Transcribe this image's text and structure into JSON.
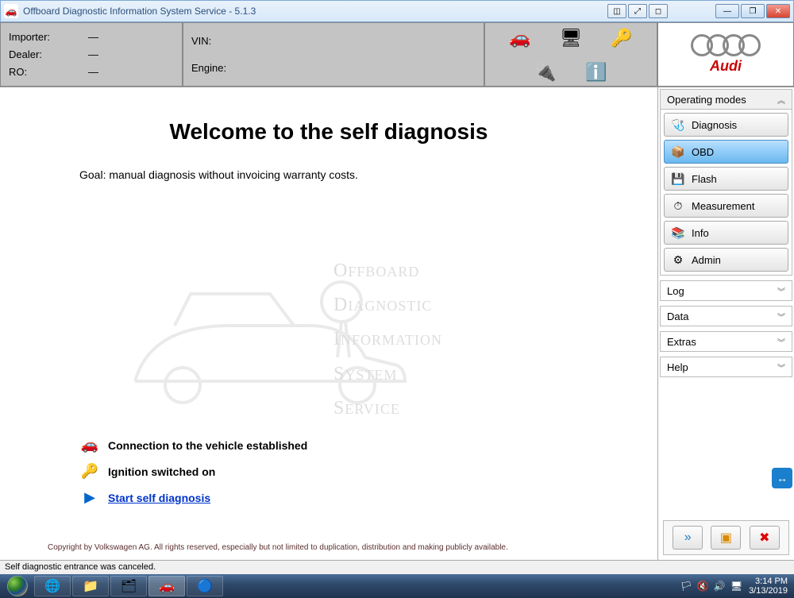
{
  "titlebar": {
    "title": "Offboard Diagnostic Information System Service - 5.1.3"
  },
  "header": {
    "importer_label": "Importer:",
    "importer_val": "—",
    "dealer_label": "Dealer:",
    "dealer_val": "—",
    "ro_label": "RO:",
    "ro_val": "—",
    "vin_label": "VIN:",
    "vin_val": "",
    "engine_label": "Engine:",
    "engine_val": "",
    "brand": "Audi"
  },
  "main": {
    "title": "Welcome to the self diagnosis",
    "goal": "Goal: manual diagnosis without invoicing warranty costs.",
    "watermark_lines": [
      "Offboard",
      "Diagnostic",
      "Information",
      "System",
      "service"
    ],
    "status": {
      "connection": "Connection to the vehicle established",
      "ignition": "Ignition switched on",
      "start": "Start self diagnosis"
    },
    "copyright": "Copyright by Volkswagen AG. All rights reserved, especially but not limited to duplication, distribution and making publicly available."
  },
  "sidebar": {
    "operating_modes_label": "Operating modes",
    "items": [
      {
        "label": "Diagnosis",
        "icon": "🩺"
      },
      {
        "label": "OBD",
        "icon": "📦"
      },
      {
        "label": "Flash",
        "icon": "💾"
      },
      {
        "label": "Measurement",
        "icon": "⏱"
      },
      {
        "label": "Info",
        "icon": "📚"
      },
      {
        "label": "Admin",
        "icon": "⚙"
      }
    ],
    "collapsed": [
      {
        "label": "Log"
      },
      {
        "label": "Data"
      },
      {
        "label": "Extras"
      },
      {
        "label": "Help"
      }
    ]
  },
  "statusbar": {
    "message": "Self diagnostic entrance was canceled."
  },
  "taskbar": {
    "time": "3:14 PM",
    "date": "3/13/2019"
  }
}
